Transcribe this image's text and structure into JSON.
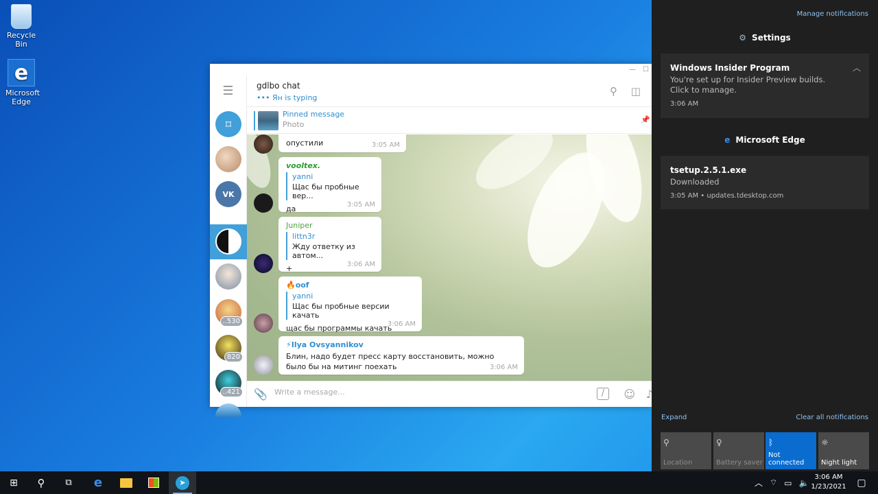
{
  "desktop": {
    "icons": [
      {
        "label": "Recycle Bin"
      },
      {
        "label": "Microsoft Edge"
      }
    ]
  },
  "telegram": {
    "chat": {
      "title": "gdlbo chat",
      "status": "••• Ян is typing"
    },
    "pinned": {
      "title": "Pinned message",
      "subtitle": "Photo"
    },
    "sidebar": {
      "badges": [
        "..530",
        "820",
        "..421"
      ]
    },
    "messages": [
      {
        "text": "опустили",
        "time": "3:05 AM"
      },
      {
        "sender": "vooltex.",
        "sender_color": "#2a9d2a",
        "reply_name": "yanni",
        "reply_text": "Щас бы пробные вер...",
        "text": "да",
        "time": "3:05 AM"
      },
      {
        "sender": "Juniper",
        "sender_color": "#4aa33c",
        "reply_name": "littn3r",
        "reply_text": "Жду ответку из автом...",
        "text": "+",
        "time": "3:06 AM"
      },
      {
        "sender": "🔥oof",
        "sender_color": "#2f8fd1",
        "reply_name": "yanni",
        "reply_text": "Щас бы пробные версии качать",
        "text": "щас бы программы качать",
        "time": "3:06 AM"
      },
      {
        "sender": "⚡Ilya Ovsyannikov",
        "sender_color": "#2f8fd1",
        "text": "Блин, надо будет пресс карту восстановить, можно было бы на митинг поехать",
        "time": "3:06 AM"
      }
    ],
    "composer": {
      "placeholder": "Write a message..."
    }
  },
  "action_center": {
    "manage_label": "Manage notifications",
    "groups": [
      {
        "app": "Settings",
        "notifications": [
          {
            "title": "Windows Insider Program",
            "body": "You're set up for Insider Preview builds. Click to manage.",
            "meta": "3:06 AM"
          }
        ]
      },
      {
        "app": "Microsoft Edge",
        "notifications": [
          {
            "title": "tsetup.2.5.1.exe",
            "body": "Downloaded",
            "meta": "3:05 AM • updates.tdesktop.com"
          }
        ]
      }
    ],
    "expand_label": "Expand",
    "clear_label": "Clear all notifications",
    "quick_actions": [
      {
        "label": "Location",
        "state": "off"
      },
      {
        "label": "Battery saver",
        "state": "off"
      },
      {
        "label": "Not connected",
        "state": "on"
      },
      {
        "label": "Night light",
        "state": "lit"
      }
    ]
  },
  "taskbar": {
    "time": "3:06 AM",
    "date": "1/23/2021"
  }
}
